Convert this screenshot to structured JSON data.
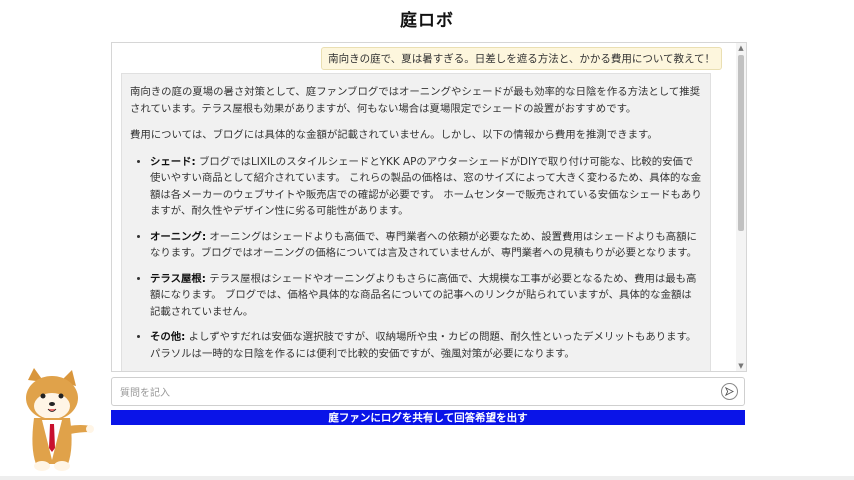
{
  "app": {
    "title": "庭ロボ"
  },
  "chat": {
    "user_message": "南向きの庭で、夏は暑すぎる。日差しを遮る方法と、かかる費用について教えて！",
    "bot": {
      "paragraph1": "南向きの庭の夏場の暑さ対策として、庭ファンブログではオーニングやシェードが最も効率的な日陰を作る方法として推奨されています。テラス屋根も効果がありますが、何もない場合は夏場限定でシェードの設置がおすすめです。",
      "paragraph2": "費用については、ブログには具体的な金額が記載されていません。しかし、以下の情報から費用を推測できます。",
      "items": [
        {
          "term": "シェード:",
          "text": " ブログではLIXILのスタイルシェードとYKK APのアウターシェードがDIYで取り付け可能な、比較的安価で使いやすい商品として紹介されています。 これらの製品の価格は、窓のサイズによって大きく変わるため、具体的な金額は各メーカーのウェブサイトや販売店での確認が必要です。 ホームセンターで販売されている安価なシェードもありますが、耐久性やデザイン性に劣る可能性があります。"
        },
        {
          "term": "オーニング:",
          "text": " オーニングはシェードよりも高価で、専門業者への依頼が必要なため、設置費用はシェードよりも高額になります。ブログではオーニングの価格については言及されていませんが、専門業者への見積もりが必要となります。"
        },
        {
          "term": "テラス屋根:",
          "text": " テラス屋根はシェードやオーニングよりもさらに高価で、大規模な工事が必要となるため、費用は最も高額になります。 ブログでは、価格や具体的な商品名についての記事へのリンクが貼られていますが、具体的な金額は記載されていません。"
        },
        {
          "term": "その他:",
          "text": " よしずやすだれは安価な選択肢ですが、収納場所や虫・カビの問題、耐久性といったデメリットもあります。パラソルは一時的な日陰を作るには便利で比較的安価ですが、強風対策が必要になります。"
        }
      ]
    }
  },
  "input": {
    "placeholder": "質問を記入"
  },
  "submit": {
    "label": "庭ファンにログを共有して回答希望を出す"
  },
  "icons": {
    "send": "send-icon",
    "mascot": "shiba-dog-mascot"
  },
  "colors": {
    "submit_bg": "#0a14e8",
    "user_bubble": "#fdf6dd",
    "bot_bubble": "#f1f1f1"
  }
}
